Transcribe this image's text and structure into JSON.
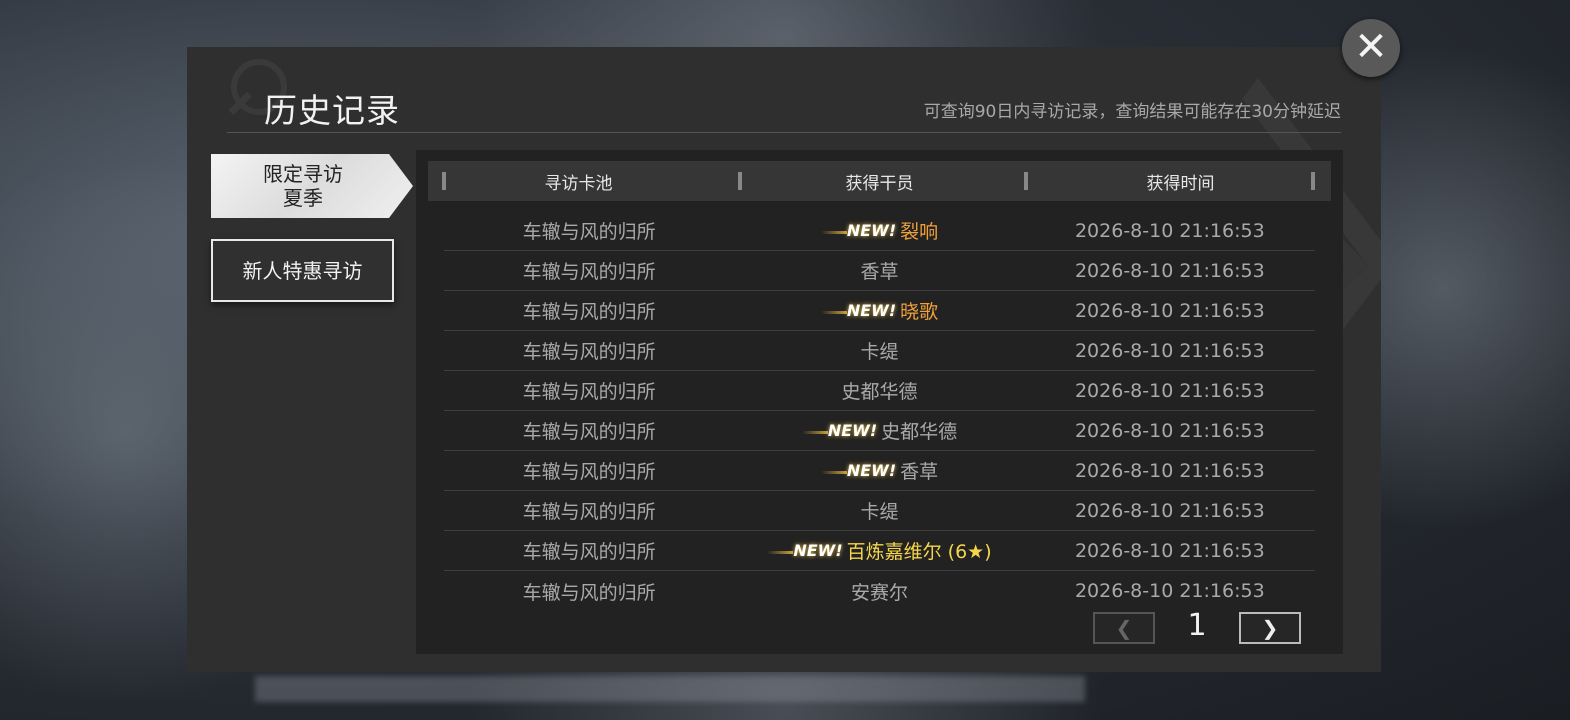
{
  "header": {
    "title": "历史记录",
    "subtitle": "可查询90日内寻访记录，查询结果可能存在30分钟延迟"
  },
  "tabs": [
    {
      "line1": "限定寻访",
      "line2": "夏季",
      "active": true
    },
    {
      "label": "新人特惠寻访",
      "active": false
    }
  ],
  "table": {
    "columns": [
      "寻访卡池",
      "获得干员",
      "获得时间"
    ],
    "rows": [
      {
        "pool": "车辙与风的归所",
        "new": true,
        "operator": "裂响",
        "rarity": "orange",
        "time": "2026-8-10 21:16:53"
      },
      {
        "pool": "车辙与风的归所",
        "new": false,
        "operator": "香草",
        "rarity": "grey",
        "time": "2026-8-10 21:16:53"
      },
      {
        "pool": "车辙与风的归所",
        "new": true,
        "operator": "晓歌",
        "rarity": "orange",
        "time": "2026-8-10 21:16:53"
      },
      {
        "pool": "车辙与风的归所",
        "new": false,
        "operator": "卡缇",
        "rarity": "grey",
        "time": "2026-8-10 21:16:53"
      },
      {
        "pool": "车辙与风的归所",
        "new": false,
        "operator": "史都华德",
        "rarity": "grey",
        "time": "2026-8-10 21:16:53"
      },
      {
        "pool": "车辙与风的归所",
        "new": true,
        "operator": "史都华德",
        "rarity": "grey",
        "time": "2026-8-10 21:16:53"
      },
      {
        "pool": "车辙与风的归所",
        "new": true,
        "operator": "香草",
        "rarity": "grey",
        "time": "2026-8-10 21:16:53"
      },
      {
        "pool": "车辙与风的归所",
        "new": false,
        "operator": "卡缇",
        "rarity": "grey",
        "time": "2026-8-10 21:16:53"
      },
      {
        "pool": "车辙与风的归所",
        "new": true,
        "operator": "百炼嘉维尔 (6★)",
        "rarity": "yellow",
        "time": "2026-8-10 21:16:53"
      },
      {
        "pool": "车辙与风的归所",
        "new": false,
        "operator": "安赛尔",
        "rarity": "grey",
        "time": "2026-8-10 21:16:53"
      }
    ],
    "new_badge": "NEW!"
  },
  "pager": {
    "current_page": "1",
    "prev_icon": "chevron-left-icon",
    "next_icon": "chevron-right-icon"
  },
  "close": {
    "icon": "close-icon",
    "glyph": "✕"
  },
  "colors": {
    "orange": "#f0a03a",
    "yellow": "#f5d64a",
    "grey": "#a9a9a9"
  }
}
